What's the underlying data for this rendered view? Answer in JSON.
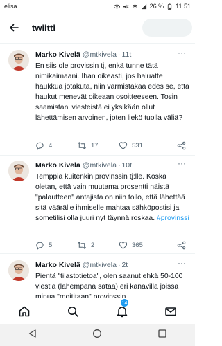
{
  "statusbar": {
    "carrier": "elisa",
    "battery": "26 %",
    "time": "11.51"
  },
  "header": {
    "title": "twiitti"
  },
  "tweets": [
    {
      "name": "Marko Kivelä",
      "handle": "@mtkivela",
      "time": "11t",
      "text": "En siis ole provissin tj, enkä tunne tätä nimikaimaani. Ihan oikeasti, jos haluatte haukkua jotakuta, niin varmistakaa edes se, että haukut menevät oikeaan osoitteeseen. Tosin saamistani viesteistä ei yksikään ollut lähettämisen arvoinen, joten liekö tuolla väliä?",
      "replies": "4",
      "retweets": "17",
      "likes": "531"
    },
    {
      "name": "Marko Kivelä",
      "handle": "@mtkivela",
      "time": "10t",
      "text": "Temppiä kuitenkin provinssin tj:lle. Koska oletan, että vain muutama prosentti näistä \"palautteen\" antajista on niin tollo, että lähettää sitä väärälle ihmiselle mahtaa sähköpostisi ja sometilisi olla juuri nyt täynnä roskaa.",
      "hashtag": "#provinssi",
      "replies": "5",
      "retweets": "2",
      "likes": "365"
    },
    {
      "name": "Marko Kivelä",
      "handle": "@mtkivela",
      "time": "2t",
      "text": "Pientä \"tilastotietoa\", olen saanut ehkä 50-100 viestiä (lähempänä sataa) eri kanavilla joissa minua \"moititaan\" provinssin"
    }
  ],
  "bottom_nav": {
    "notifications_badge": "14"
  },
  "colors": {
    "accent": "#1d9bf0",
    "secondary_text": "#536471",
    "primary_text": "#0f1419"
  }
}
